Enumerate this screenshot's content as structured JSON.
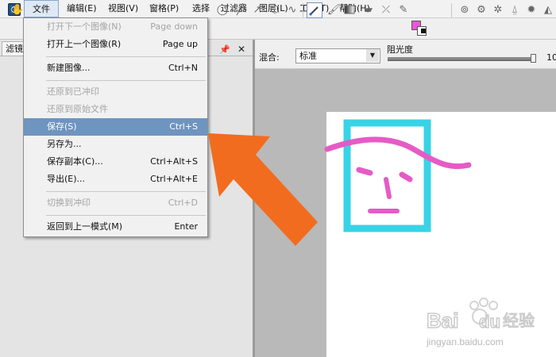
{
  "menubar": {
    "items": [
      "文件(F)",
      "编辑(E)",
      "视图(V)",
      "窗格(P)",
      "选择",
      "过滤器",
      "图层(L)",
      "工具(T)",
      "帮助(H)"
    ]
  },
  "left_panel": {
    "tab_label": "滤镜"
  },
  "options": {
    "blend_label": "混合:",
    "blend_value": "标准",
    "opacity_label": "阻光度",
    "opacity_value": "10",
    "opacity_level_percent": 100
  },
  "file_menu": {
    "items": [
      {
        "label": "打开下一个图像(N)",
        "shortcut": "Page down"
      },
      {
        "label": "打开上一个图像(R)",
        "shortcut": "Page up"
      },
      {
        "label": "新建图像...",
        "shortcut": "Ctrl+N"
      },
      {
        "label": "还原到已冲印",
        "shortcut": ""
      },
      {
        "label": "还原到原始文件",
        "shortcut": ""
      },
      {
        "label": "保存(S)",
        "shortcut": "Ctrl+S"
      },
      {
        "label": "另存为...",
        "shortcut": ""
      },
      {
        "label": "保存副本(C)...",
        "shortcut": "Ctrl+Alt+S"
      },
      {
        "label": "导出(E)...",
        "shortcut": "Ctrl+Alt+E"
      },
      {
        "label": "切换到冲印",
        "shortcut": "Ctrl+D"
      },
      {
        "label": "返回到上一模式(M)",
        "shortcut": "Enter"
      }
    ]
  },
  "toolbar": {
    "icons": [
      "hand-icon",
      "ellipse-icon",
      "line-icon",
      "arrow-line-icon",
      "polygon-icon",
      "curve-icon",
      "brush-icon",
      "color-picker-icon",
      "gradient-icon",
      "eraser-icon",
      "clone-icon",
      "eyedropper-icon",
      "color-swatch-icon",
      "zoom-icon",
      "settings-icon",
      "gear-icon",
      "light-icon",
      "sun-icon",
      "fill-icon"
    ]
  },
  "watermark": {
    "brand": "Bai du 经验",
    "url": "jingyan.baidu.com"
  },
  "colors": {
    "highlight": "#6e94c0",
    "arrow": "#f26c1f",
    "rect_stroke": "#38d3e6",
    "brush_stroke": "#e55bc6",
    "primary_swatch": "#ee55dd"
  }
}
